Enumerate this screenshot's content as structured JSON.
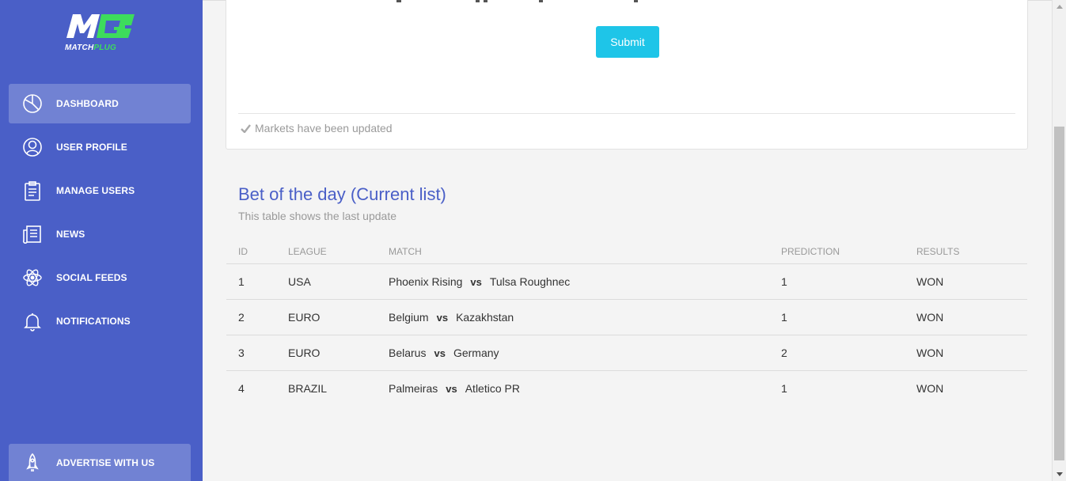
{
  "brand": {
    "logo_text_1": "MATCH",
    "logo_text_2": "PLUG"
  },
  "sidebar": {
    "items": [
      {
        "label": "DASHBOARD",
        "icon": "pie-chart-icon",
        "active": true
      },
      {
        "label": "USER PROFILE",
        "icon": "user-icon",
        "active": false
      },
      {
        "label": "MANAGE USERS",
        "icon": "clipboard-icon",
        "active": false
      },
      {
        "label": "NEWS",
        "icon": "newspaper-icon",
        "active": false
      },
      {
        "label": "SOCIAL FEEDS",
        "icon": "atom-icon",
        "active": false
      },
      {
        "label": "NOTIFICATIONS",
        "icon": "bell-icon",
        "active": false
      }
    ],
    "advertise": {
      "label": "ADVERTISE WITH US",
      "icon": "rocket-icon"
    }
  },
  "card": {
    "submit_label": "Submit",
    "status_text": "Markets have been updated"
  },
  "section": {
    "title": "Bet of the day (Current list)",
    "subtitle": "This table shows the last update"
  },
  "table": {
    "headers": [
      "ID",
      "LEAGUE",
      "MATCH",
      "PREDICTION",
      "RESULTS"
    ],
    "vs_label": "vs",
    "rows": [
      {
        "id": "1",
        "league": "USA",
        "home": "Phoenix Rising",
        "away": "Tulsa Roughnec",
        "prediction": "1",
        "result": "WON"
      },
      {
        "id": "2",
        "league": "EURO",
        "home": "Belgium",
        "away": "Kazakhstan",
        "prediction": "1",
        "result": "WON"
      },
      {
        "id": "3",
        "league": "EURO",
        "home": "Belarus",
        "away": "Germany",
        "prediction": "2",
        "result": "WON"
      },
      {
        "id": "4",
        "league": "BRAZIL",
        "home": "Palmeiras",
        "away": "Atletico PR",
        "prediction": "1",
        "result": "WON"
      }
    ]
  },
  "colors": {
    "sidebar": "#4a5fc7",
    "accent": "#1ec5e8",
    "title": "#4a5fc7",
    "logo_green": "#3ddc5c"
  }
}
